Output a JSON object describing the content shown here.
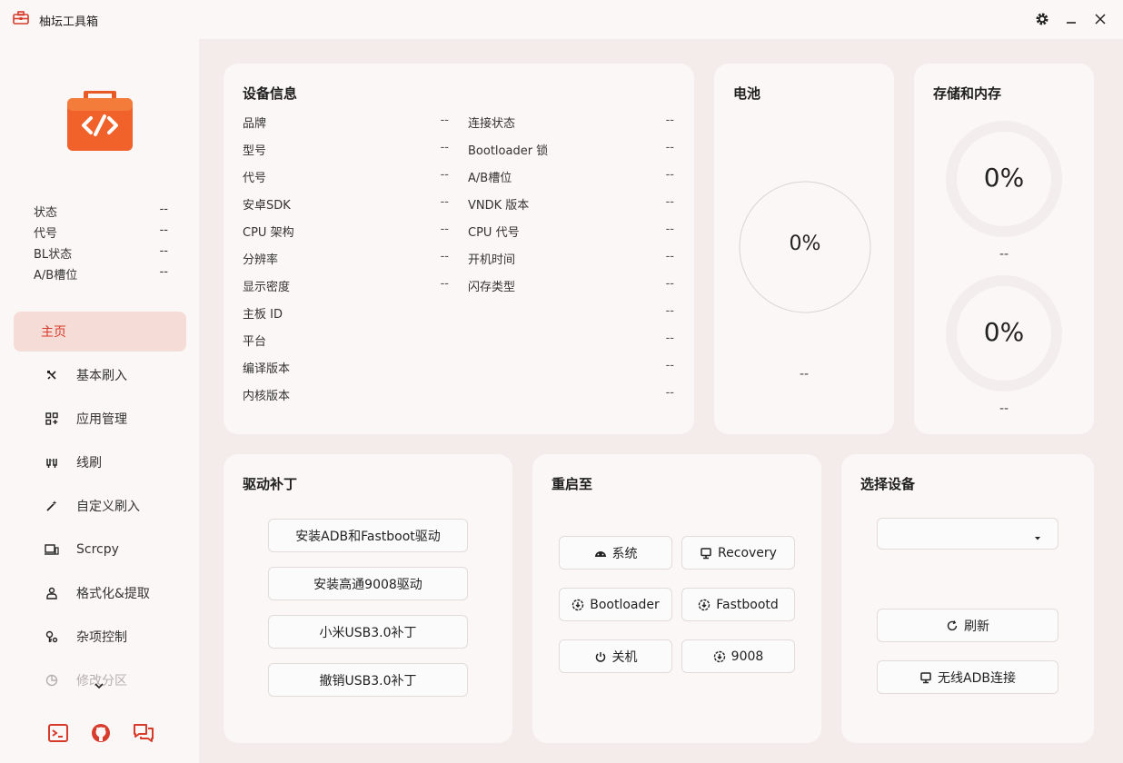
{
  "app": {
    "title": "柚坛工具箱"
  },
  "colors": {
    "accent": "#d63b2b",
    "logo_orange": "#f0622a",
    "active_bg": "#f5dcd7"
  },
  "sidebar": {
    "status": [
      {
        "label": "状态",
        "value": "--"
      },
      {
        "label": "代号",
        "value": "--"
      },
      {
        "label": "BL状态",
        "value": "--"
      },
      {
        "label": "A/B槽位",
        "value": "--"
      }
    ],
    "nav": [
      {
        "label": "主页",
        "icon": "home-icon",
        "active": true
      },
      {
        "label": "基本刷入",
        "icon": "flash-icon"
      },
      {
        "label": "应用管理",
        "icon": "apps-icon"
      },
      {
        "label": "线刷",
        "icon": "cable-icon"
      },
      {
        "label": "自定义刷入",
        "icon": "magic-wand-icon"
      },
      {
        "label": "Scrcpy",
        "icon": "devices-icon"
      },
      {
        "label": "格式化&提取",
        "icon": "person-icon"
      },
      {
        "label": "杂项控制",
        "icon": "key-icon"
      },
      {
        "label": "修改分区",
        "icon": "pie-chart-icon"
      }
    ],
    "bottom_icons": [
      "terminal-icon",
      "github-icon",
      "chat-icon"
    ]
  },
  "device_info": {
    "title": "设备信息",
    "left": [
      {
        "label": "品牌",
        "value": "--"
      },
      {
        "label": "型号",
        "value": "--"
      },
      {
        "label": "代号",
        "value": "--"
      },
      {
        "label": "安卓SDK",
        "value": "--"
      },
      {
        "label": "CPU 架构",
        "value": "--"
      },
      {
        "label": "分辨率",
        "value": "--"
      },
      {
        "label": "显示密度",
        "value": "--"
      }
    ],
    "right": [
      {
        "label": "连接状态",
        "value": "--"
      },
      {
        "label": "Bootloader 锁",
        "value": "--"
      },
      {
        "label": "A/B槽位",
        "value": "--"
      },
      {
        "label": "VNDK 版本",
        "value": "--"
      },
      {
        "label": "CPU 代号",
        "value": "--"
      },
      {
        "label": "开机时间",
        "value": "--"
      },
      {
        "label": "闪存类型",
        "value": "--"
      }
    ],
    "full": [
      {
        "label": "主板 ID",
        "value": "--"
      },
      {
        "label": "平台",
        "value": "--"
      },
      {
        "label": "编译版本",
        "value": "--"
      },
      {
        "label": "内核版本",
        "value": "--"
      }
    ]
  },
  "battery": {
    "title": "电池",
    "percent": "0%",
    "value": 0,
    "detail": "--"
  },
  "storage": {
    "title": "存储和内存",
    "storage_percent": "0%",
    "storage_value": 0,
    "storage_detail": "--",
    "memory_percent": "0%",
    "memory_value": 0,
    "memory_detail": "--"
  },
  "driver": {
    "title": "驱动补丁",
    "buttons": [
      "安装ADB和Fastboot驱动",
      "安装高通9008驱动",
      "小米USB3.0补丁",
      "撤销USB3.0补丁"
    ]
  },
  "reboot": {
    "title": "重启至",
    "buttons": [
      {
        "label": "系统",
        "icon": "android-icon"
      },
      {
        "label": "Recovery",
        "icon": "monitor-icon"
      },
      {
        "label": "Bootloader",
        "icon": "arrow-circle-icon"
      },
      {
        "label": "Fastbootd",
        "icon": "arrow-circle-icon"
      },
      {
        "label": "关机",
        "icon": "power-icon"
      },
      {
        "label": "9008",
        "icon": "arrow-circle-icon"
      }
    ]
  },
  "device_select": {
    "title": "选择设备",
    "selected": "",
    "refresh_label": "刷新",
    "wireless_label": "无线ADB连接"
  }
}
